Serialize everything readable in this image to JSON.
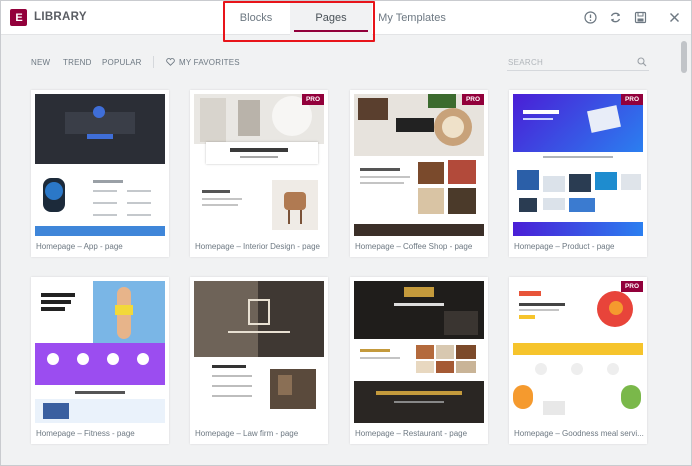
{
  "header": {
    "logo_glyph": "E",
    "title": "LIBRARY",
    "tabs": [
      {
        "label": "Blocks",
        "active": false
      },
      {
        "label": "Pages",
        "active": true
      },
      {
        "label": "My Templates",
        "active": false
      }
    ],
    "icons": [
      "info-icon",
      "sync-icon",
      "save-icon",
      "close-icon"
    ],
    "accent_color": "#92003b",
    "highlight_color": "#e8141a"
  },
  "toolbar": {
    "filters": [
      "NEW",
      "TREND",
      "POPULAR"
    ],
    "favorites_label": "MY FAVORITES",
    "search_placeholder": "SEARCH"
  },
  "badge_label": "PRO",
  "templates": [
    {
      "label": "Homepage – App - page",
      "pro": false
    },
    {
      "label": "Homepage – Interior Design - page",
      "pro": true
    },
    {
      "label": "Homepage – Coffee Shop - page",
      "pro": true
    },
    {
      "label": "Homepage – Product - page",
      "pro": true
    },
    {
      "label": "Homepage – Fitness - page",
      "pro": false
    },
    {
      "label": "Homepage – Law firm - page",
      "pro": false
    },
    {
      "label": "Homepage – Restaurant - page",
      "pro": false
    },
    {
      "label": "Homepage – Goodness meal servi...",
      "pro": true
    }
  ]
}
